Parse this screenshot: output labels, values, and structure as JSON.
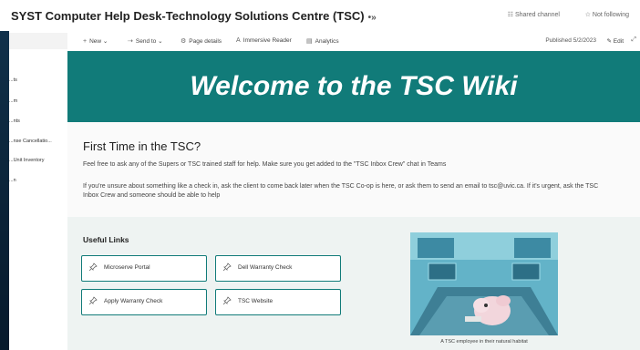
{
  "site": {
    "title": "SYST Computer Help Desk-Technology Solutions Centre (TSC)",
    "title_icon": "•»",
    "shared_channel": "Shared channel",
    "not_following": "Not following"
  },
  "sidebar": {
    "items": [
      "...ts",
      "...m",
      "...nts",
      "...nse Cancellatio...",
      "...Unit Inventory",
      "...n"
    ]
  },
  "commandbar": {
    "new": "New",
    "send_to": "Send to",
    "page_details": "Page details",
    "immersive_reader": "Immersive Reader",
    "analytics": "Analytics",
    "published": "Published 5/2/2023",
    "edit": "Edit"
  },
  "banner": {
    "title": "Welcome to the TSC Wiki"
  },
  "first_time": {
    "heading": "First Time in the TSC?",
    "para1": "Feel free to ask any of the Supers or TSC trained staff for help. Make sure you get added to the \"TSC Inbox Crew\" chat in Teams",
    "para2": "If you're unsure about something like a check in, ask the client to come back later when the TSC Co-op is here, or ask them to send an email to tsc@uvic.ca. If it's urgent, ask the TSC Inbox Crew and someone should be able to help"
  },
  "useful_links": {
    "title": "Useful Links",
    "links": [
      "Microserve Portal",
      "Dell Warranty Check",
      "Apply Warranty Check",
      "TSC Website"
    ]
  },
  "image": {
    "caption": "A TSC employee in their natural habitat"
  },
  "colors": {
    "accent": "#117b79",
    "banner": "#117b79"
  }
}
